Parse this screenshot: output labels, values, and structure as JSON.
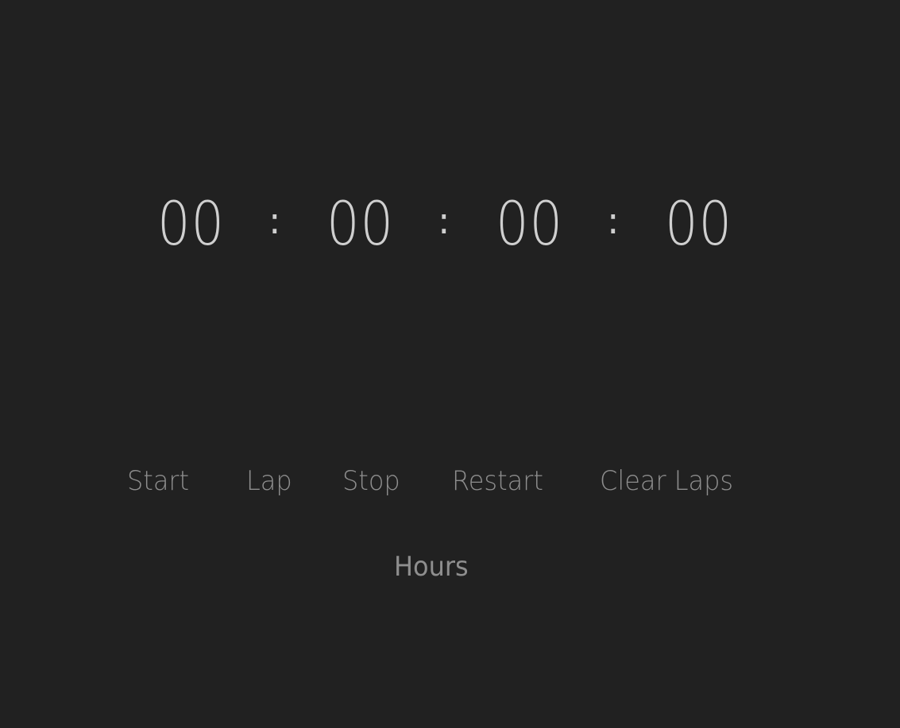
{
  "timer": {
    "hours": "00",
    "minutes": "00",
    "seconds": "00",
    "centiseconds": "00",
    "separator": ":"
  },
  "controls": {
    "start_label": "Start",
    "lap_label": "Lap",
    "stop_label": "Stop",
    "restart_label": "Restart",
    "clear_laps_label": "Clear Laps",
    "hours_label": "Hours"
  },
  "colors": {
    "background": "#212121",
    "digits": "#cfcfcf",
    "buttons": "#8e8e8e"
  }
}
